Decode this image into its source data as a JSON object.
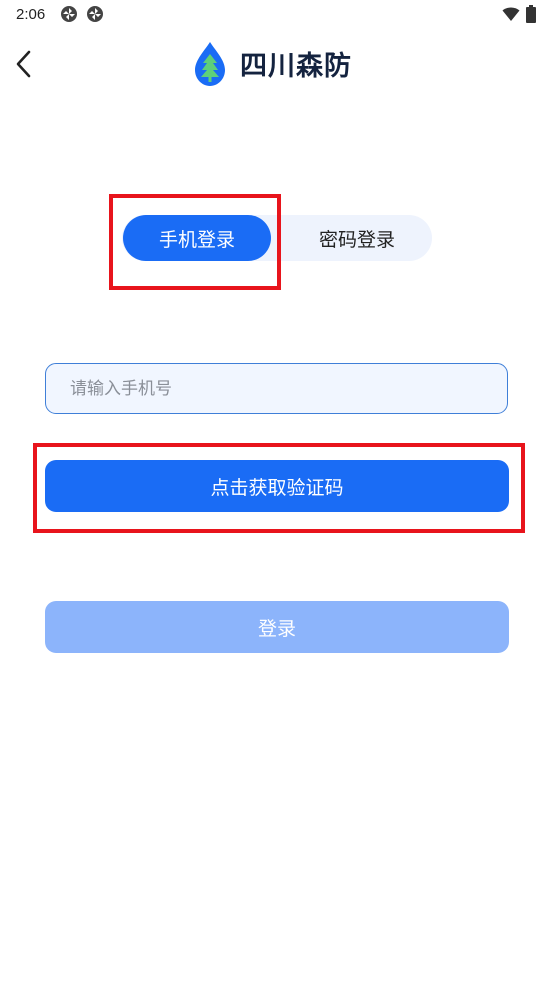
{
  "status_bar": {
    "time": "2:06",
    "icons": [
      "pinwheel-icon",
      "pinwheel-icon",
      "wifi-icon",
      "battery-icon"
    ]
  },
  "header": {
    "back_icon": "chevron-left-icon",
    "logo_icon": "tree-drop-icon",
    "title": "四川森防"
  },
  "tabs": [
    {
      "label": "手机登录",
      "active": true
    },
    {
      "label": "密码登录",
      "active": false
    }
  ],
  "form": {
    "phone_placeholder": "请输入手机号",
    "phone_value": "",
    "get_code_label": "点击获取验证码",
    "login_label": "登录"
  },
  "colors": {
    "primary": "#1a6cf5",
    "primary_disabled": "#8cb4fb",
    "tab_bg": "#eef3fd",
    "input_bg": "#f1f6ff",
    "input_border": "#3f7fd8",
    "highlight": "#e8141c",
    "title": "#14233f"
  }
}
